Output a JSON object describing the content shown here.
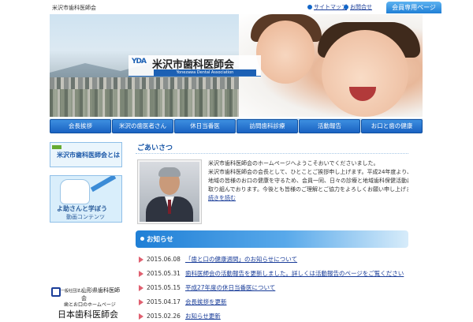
{
  "topbar": {
    "tagline": "米沢市歯科医師会",
    "links": [
      {
        "label": "サイトマップ"
      },
      {
        "label": "お問合せ"
      }
    ],
    "member_button": "会員専用ページ"
  },
  "hero": {
    "logo_mark": "YDA",
    "logo_name": "米沢市歯科医師会",
    "logo_en": "Yonezawa Dental Association"
  },
  "nav": {
    "items": [
      {
        "label": "会長挨拶"
      },
      {
        "label": "米沢の歯医者さん"
      },
      {
        "label": "休日当番医"
      },
      {
        "label": "訪問歯科診療"
      },
      {
        "label": "活動報告"
      },
      {
        "label": "お口と歯の健康"
      }
    ]
  },
  "sidebar": {
    "banner1": "米沢市歯科医師会とは",
    "banner2_title": "よ助さんと学ぼう",
    "banner2_sub": "動画コンテンツ",
    "assoc1_small": "一般社団法人",
    "assoc1_name": "山形県歯科医師会",
    "assoc2_small": "歯とお口のホームページ",
    "assoc2_name": "日本歯科医師会"
  },
  "aisatsu": {
    "heading": "ごあいさつ",
    "lines": [
      "米沢市歯科医師会のホームページへようこそおいでくださいました。",
      "米沢市歯科医師会の会長として、ひとことご挨拶申し上げます。平成24年度より、",
      "地域の皆様のお口の健康を守るため、会員一同、日々の診療と地域歯科保健活動に",
      "取り組んでおります。今後とも皆様のご理解とご協力をよろしくお願い申し上げます。"
    ],
    "more": "続きを読む"
  },
  "news": {
    "heading": "お知らせ",
    "items": [
      {
        "date": "2015.06.08",
        "title": "「歯と口の健康週間」のお知らせについて"
      },
      {
        "date": "2015.05.31",
        "title": "歯科医師会の活動報告を更新しました。詳しくは活動報告のページをご覧ください"
      },
      {
        "date": "2015.05.15",
        "title": "平成27年度の休日当番医について"
      },
      {
        "date": "2015.04.17",
        "title": "会長挨拶を更新"
      },
      {
        "date": "2015.02.26",
        "title": "お知らせ更新"
      }
    ]
  }
}
